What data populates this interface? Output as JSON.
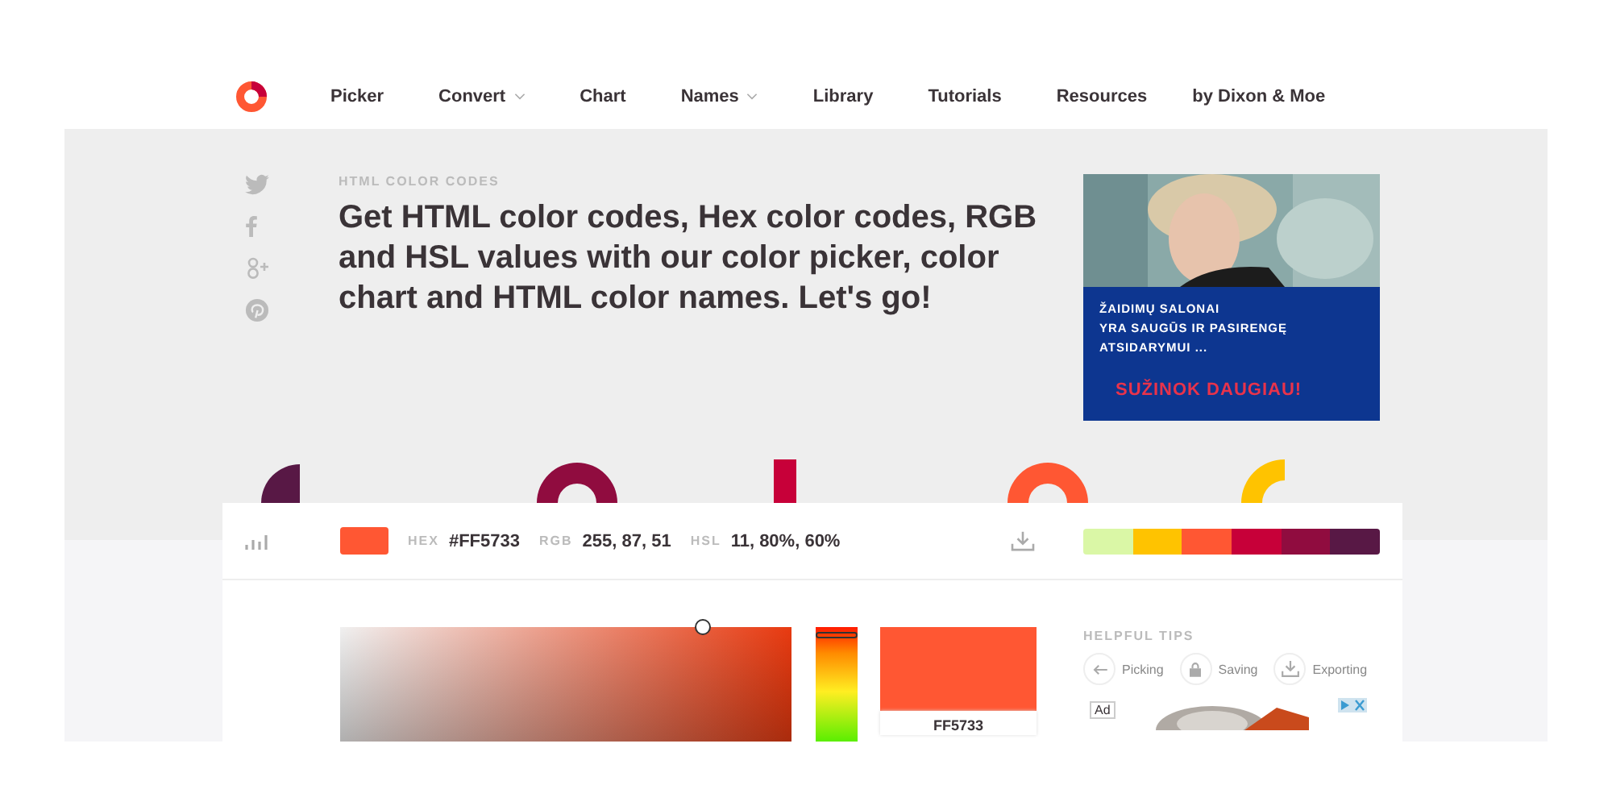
{
  "nav": {
    "items": [
      {
        "label": "Picker",
        "dropdown": false
      },
      {
        "label": "Convert",
        "dropdown": true
      },
      {
        "label": "Chart",
        "dropdown": false
      },
      {
        "label": "Names",
        "dropdown": true
      },
      {
        "label": "Library",
        "dropdown": false
      },
      {
        "label": "Tutorials",
        "dropdown": false
      },
      {
        "label": "Resources",
        "dropdown": false
      },
      {
        "label": "by Dixon & Moe",
        "dropdown": false
      }
    ]
  },
  "hero": {
    "eyebrow": "HTML COLOR CODES",
    "headline": "Get HTML color codes, Hex color codes, RGB and HSL values with our color picker, color chart and HTML color names. Let's go!"
  },
  "ad_banner": {
    "lines": [
      "ŽAIDIMŲ SALONAI",
      "YRA SAUGŪS IR PASIRENGĘ",
      "ATSIDARYMUI ..."
    ],
    "cta": "SUŽINOK DAUGIAU!"
  },
  "color_bar": {
    "color": "#ff5733",
    "fields": [
      {
        "label": "HEX",
        "value": "#FF5733"
      },
      {
        "label": "RGB",
        "value": "255, 87, 51"
      },
      {
        "label": "HSL",
        "value": "11, 80%, 60%"
      }
    ],
    "palette": [
      {
        "color": "#daf7a6"
      },
      {
        "color": "#ffc300"
      },
      {
        "color": "#ff5733"
      },
      {
        "color": "#c70039"
      },
      {
        "color": "#900c3f"
      },
      {
        "color": "#581845"
      }
    ]
  },
  "picker": {
    "hue_slider": {
      "level": 0.05
    },
    "preview_hex": "FF5733"
  },
  "tips": {
    "title": "HELPFUL TIPS",
    "items": [
      {
        "label": "Picking",
        "kind": "arrow"
      },
      {
        "label": "Saving",
        "kind": "lock"
      },
      {
        "label": "Exporting",
        "kind": "download"
      }
    ]
  },
  "ad_label": "Ad"
}
